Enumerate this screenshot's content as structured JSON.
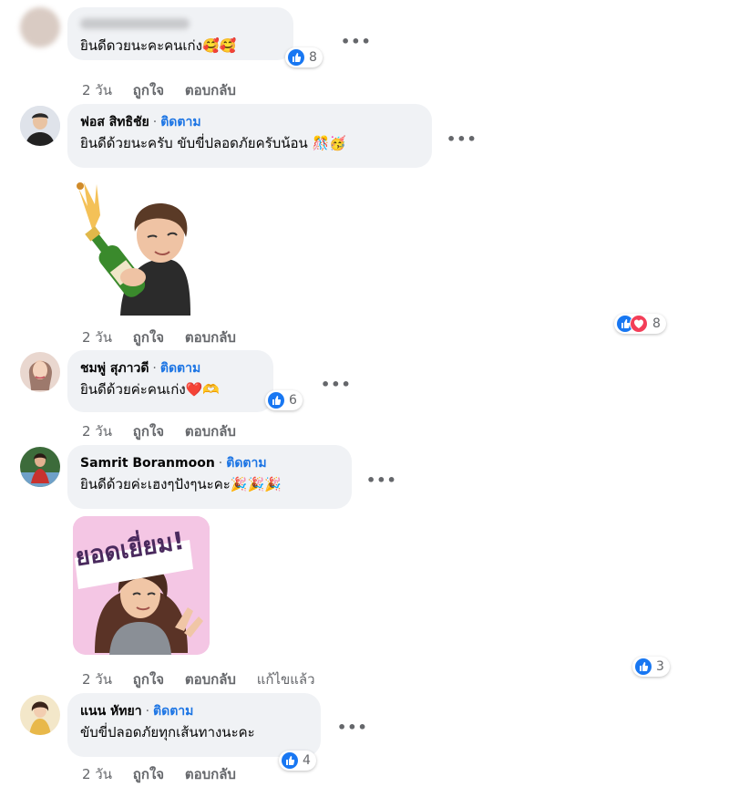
{
  "comments": [
    {
      "name": "",
      "follow_label": "",
      "text": "ยินดีดวยนะคะคนเก่ง🥰🥰",
      "reactions": {
        "types": [
          "like"
        ],
        "count": "8"
      },
      "actions": {
        "time": "2 วัน",
        "like": "ถูกใจ",
        "reply": "ตอบกลับ",
        "edited": ""
      }
    },
    {
      "name": "ฟอส สิทธิชัย",
      "follow_label": "ติดตาม",
      "text": "ยินดีด้วยนะครับ ขับขี่ปลอดภัยครับน้อน 🎊🥳",
      "sticker": "champagne-avatar-sticker",
      "reactions": {
        "types": [
          "like",
          "love"
        ],
        "count": "8"
      },
      "actions": {
        "time": "2 วัน",
        "like": "ถูกใจ",
        "reply": "ตอบกลับ",
        "edited": ""
      }
    },
    {
      "name": "ชมพู่ สุภาวดี",
      "follow_label": "ติดตาม",
      "text": "ยินดีด้วยค่ะคนเก่ง❤️🫶",
      "reactions": {
        "types": [
          "like"
        ],
        "count": "6"
      },
      "actions": {
        "time": "2 วัน",
        "like": "ถูกใจ",
        "reply": "ตอบกลับ",
        "edited": ""
      }
    },
    {
      "name": "Samrit Boranmoon",
      "follow_label": "ติดตาม",
      "text": "ยินดีด้วยค่ะเฮงๆปังๆนะคะ🎉🎉🎉",
      "sticker": "ยอดเยี่ยม!",
      "reactions": {
        "types": [
          "like"
        ],
        "count": "3"
      },
      "actions": {
        "time": "2 วัน",
        "like": "ถูกใจ",
        "reply": "ตอบกลับ",
        "edited": "แก้ไขแล้ว"
      }
    },
    {
      "name": "แนน หัทยา",
      "follow_label": "ติดตาม",
      "text": "ขับขี่ปลอดภัยทุกเส้นทางนะคะ",
      "reactions": {
        "types": [
          "like"
        ],
        "count": "4"
      },
      "actions": {
        "time": "2 วัน",
        "like": "ถูกใจ",
        "reply": "ตอบกลับ",
        "edited": ""
      }
    }
  ],
  "more_icon": "•••",
  "colors": {
    "follow": "#1b74e4",
    "like": "#1877f2",
    "love": "#f33e58",
    "bubble": "#f0f2f5",
    "meta": "#65676b"
  }
}
